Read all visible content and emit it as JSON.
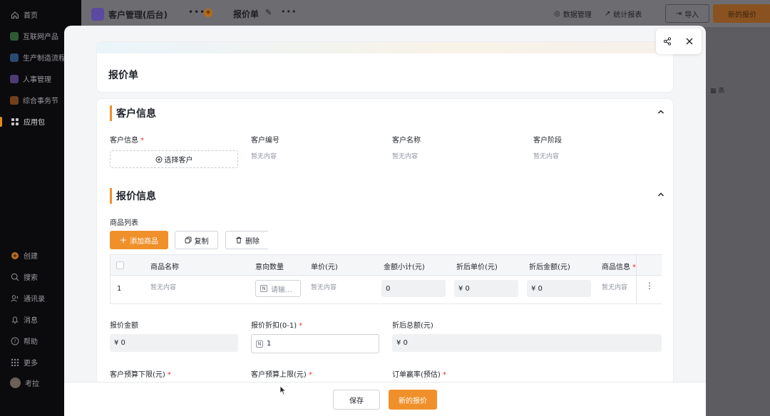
{
  "sidebar": {
    "items": [
      {
        "label": "首页",
        "icon": "home-icon"
      },
      {
        "label": "互联网产品",
        "icon": "app-icon",
        "color": "#2d8a3e"
      },
      {
        "label": "生产制造流程",
        "icon": "app-icon",
        "color": "#3a78c0"
      },
      {
        "label": "人事管理",
        "icon": "app-icon",
        "color": "#8a5cc7"
      },
      {
        "label": "综合事务节",
        "icon": "app-icon",
        "color": "#d06a28"
      },
      {
        "label": "应用包",
        "icon": "grid-icon"
      },
      {
        "label": "创建",
        "icon": "plus-circle-icon"
      },
      {
        "label": "搜索",
        "icon": "search-icon"
      },
      {
        "label": "通讯录",
        "icon": "contacts-icon"
      },
      {
        "label": "消息",
        "icon": "bell-icon"
      },
      {
        "label": "帮助",
        "icon": "help-icon"
      },
      {
        "label": "更多",
        "icon": "grid-dots-icon"
      },
      {
        "label": "考拉",
        "icon": "avatar"
      }
    ]
  },
  "topbar": {
    "app_name": "客户管理(后台)",
    "page_title": "报价单",
    "data_manage": "数据管理",
    "stats_report": "统计报表",
    "import": "导入",
    "new_quote_top": "新的报价"
  },
  "modal": {
    "title": "报价单",
    "customer_section": {
      "title": "客户信息",
      "fields": [
        {
          "label": "客户信息",
          "required": true,
          "value": "选择客户"
        },
        {
          "label": "客户编号",
          "value": "暂无内容"
        },
        {
          "label": "客户名称",
          "value": "暂无内容"
        },
        {
          "label": "客户阶段",
          "value": "暂无内容"
        }
      ]
    },
    "quote_section": {
      "title": "报价信息",
      "product_list_label": "商品列表",
      "add_button": "添加商品",
      "copy_button": "复制",
      "delete_button": "删除",
      "columns": [
        "商品名称",
        "意向数量",
        "单价(元)",
        "金额小计(元)",
        "折后单价(元)",
        "折后金额(元)",
        "商品信息"
      ],
      "row": {
        "index": "1",
        "name": "暂无内容",
        "qty_placeholder": "请输...",
        "unit_price": "暂无内容",
        "subtotal": "0",
        "disc_unit": "¥ 0",
        "disc_amount": "¥ 0",
        "product_info": "暂无内容"
      },
      "quote_amount_label": "报价金额",
      "quote_amount_value": "¥ 0",
      "discount_label": "报价折扣(0-1)",
      "discount_value": "1",
      "total_after_label": "折后总额(元)",
      "total_after_value": "¥ 0",
      "budget_min_label": "客户预算下限(元)",
      "budget_max_label": "客户预算上限(元)",
      "order_rate_label": "订单赢率(预估)"
    },
    "footer": {
      "save": "保存",
      "new_quote": "新的报价"
    },
    "accent_color": "#f0902a"
  }
}
